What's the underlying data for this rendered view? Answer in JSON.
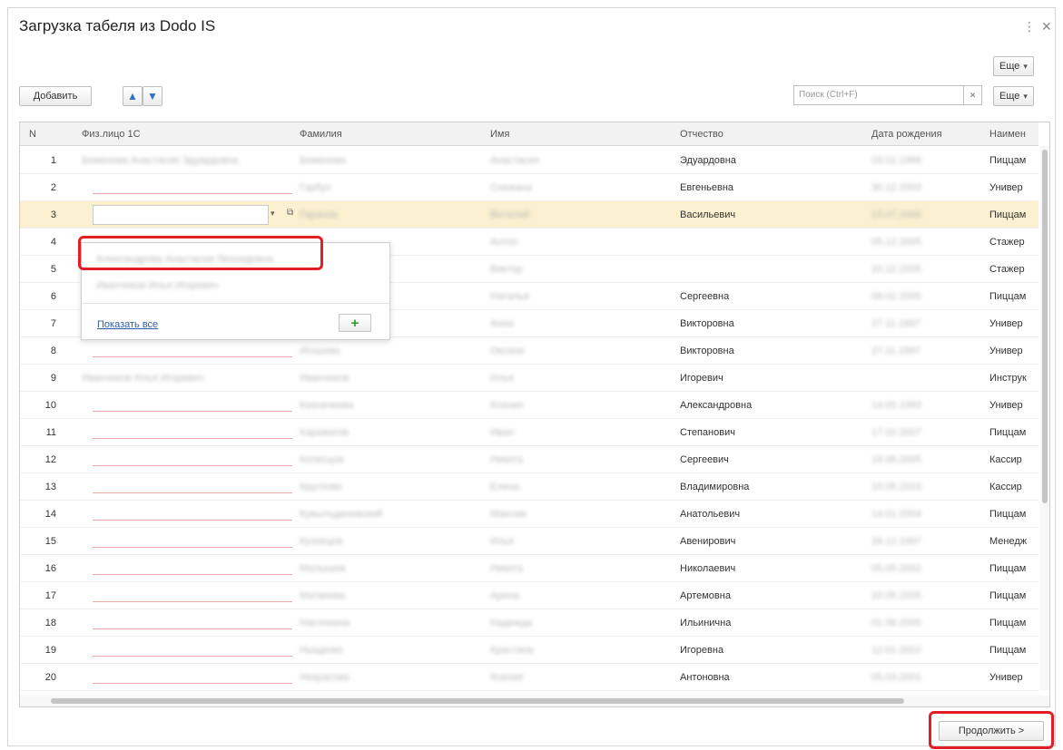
{
  "window": {
    "title": "Загрузка табеля из Dodo IS",
    "menu_icon": "more-vertical-icon",
    "close_icon": "close-icon"
  },
  "toolbar": {
    "more_top_label": "Еще",
    "add_label": "Добавить",
    "up_icon": "arrow-up-icon",
    "down_icon": "arrow-down-icon",
    "search_placeholder": "Поиск (Ctrl+F)",
    "more_label": "Еще"
  },
  "table": {
    "headers": [
      "N",
      "Физ.лицо 1С",
      "Фамилия",
      "Имя",
      "Отчество",
      "Дата рождения",
      "Наимен"
    ],
    "rows": [
      {
        "n": "1",
        "fiz": "Боженова Анастасия Эдуардовна",
        "fam": "Боженова",
        "imya": "Анастасия",
        "otch": "Эдуардовна",
        "dob": "03.02.1998",
        "naim": "Пиццам"
      },
      {
        "n": "2",
        "fiz": "",
        "fam": "Гарбуз",
        "imya": "Снежана",
        "otch": "Евгеньевна",
        "dob": "30.12.2003",
        "naim": "Универ"
      },
      {
        "n": "3",
        "fiz": "",
        "fam": "Гаранов",
        "imya": "Виталий",
        "otch": "Васильевич",
        "dob": "15.07.2006",
        "naim": "Пиццам"
      },
      {
        "n": "4",
        "fiz": "",
        "fam": "",
        "imya": "Антон",
        "otch": "",
        "dob": "05.12.2005",
        "naim": "Стажер"
      },
      {
        "n": "5",
        "fiz": "",
        "fam": "",
        "imya": "Виктор",
        "otch": "",
        "dob": "20.12.2005",
        "naim": "Стажер"
      },
      {
        "n": "6",
        "fiz": "",
        "fam": "",
        "imya": "Наталья",
        "otch": "Сергеевна",
        "dob": "06.02.2005",
        "naim": "Пиццам"
      },
      {
        "n": "7",
        "fiz": "",
        "fam": "",
        "imya": "Анна",
        "otch": "Викторовна",
        "dob": "27.11.1997",
        "naim": "Универ"
      },
      {
        "n": "8",
        "fiz": "",
        "fam": "Игошева",
        "imya": "Оксана",
        "otch": "Викторовна",
        "dob": "27.11.1997",
        "naim": "Универ"
      },
      {
        "n": "9",
        "fiz": "Иванчиков Илья Игоревич",
        "fam": "Иванчиков",
        "imya": "Илья",
        "otch": "Игоревич",
        "dob": "",
        "naim": "Инструк"
      },
      {
        "n": "10",
        "fiz": "",
        "fam": "Казначеева",
        "imya": "Ксения",
        "otch": "Александровна",
        "dob": "14.05.1993",
        "naim": "Универ"
      },
      {
        "n": "11",
        "fiz": "",
        "fam": "Каражигов",
        "imya": "Иван",
        "otch": "Степанович",
        "dob": "17.02.2007",
        "naim": "Пиццам"
      },
      {
        "n": "12",
        "fiz": "",
        "fam": "Колесцов",
        "imya": "Никита",
        "otch": "Сергеевич",
        "dob": "18.06.2005",
        "naim": "Кассир"
      },
      {
        "n": "13",
        "fiz": "",
        "fam": "Круглова",
        "imya": "Елена",
        "otch": "Владимировна",
        "dob": "15.05.2003",
        "naim": "Кассир"
      },
      {
        "n": "14",
        "fiz": "",
        "fam": "Кувыльдиневский",
        "imya": "Максим",
        "otch": "Анатольевич",
        "dob": "14.01.2004",
        "naim": "Пиццам"
      },
      {
        "n": "15",
        "fiz": "",
        "fam": "Кузнецов",
        "imya": "Илья",
        "otch": "Авенирович",
        "dob": "26.12.1997",
        "naim": "Менедж"
      },
      {
        "n": "16",
        "fiz": "",
        "fam": "Малышев",
        "imya": "Никита",
        "otch": "Николаевич",
        "dob": "05.05.2002",
        "naim": "Пиццам"
      },
      {
        "n": "17",
        "fiz": "",
        "fam": "Матвеева",
        "imya": "Арина",
        "otch": "Артемовна",
        "dob": "20.05.2005",
        "naim": "Пиццам"
      },
      {
        "n": "18",
        "fiz": "",
        "fam": "Насонкина",
        "imya": "Надежда",
        "otch": "Ильинична",
        "dob": "01.06.2005",
        "naim": "Пиццам"
      },
      {
        "n": "19",
        "fiz": "",
        "fam": "Ныщенко",
        "imya": "Кристина",
        "otch": "Игоревна",
        "dob": "12.01.2002",
        "naim": "Пиццам"
      },
      {
        "n": "20",
        "fiz": "",
        "fam": "Некрасова",
        "imya": "Ксения",
        "otch": "Антоновна",
        "dob": "05.03.2001",
        "naim": "Универ"
      }
    ]
  },
  "dropdown": {
    "item_1": "Александрова Анастасия Леонидовна",
    "item_2": "Иванчиков Илья Игоревич",
    "show_all": "Показать все",
    "plus_icon": "plus-icon"
  },
  "footer": {
    "continue_label": "Продолжить >"
  },
  "colors": {
    "highlight": "#e41e26",
    "selected_row": "#fbf0cf",
    "link": "#2a5db0"
  }
}
